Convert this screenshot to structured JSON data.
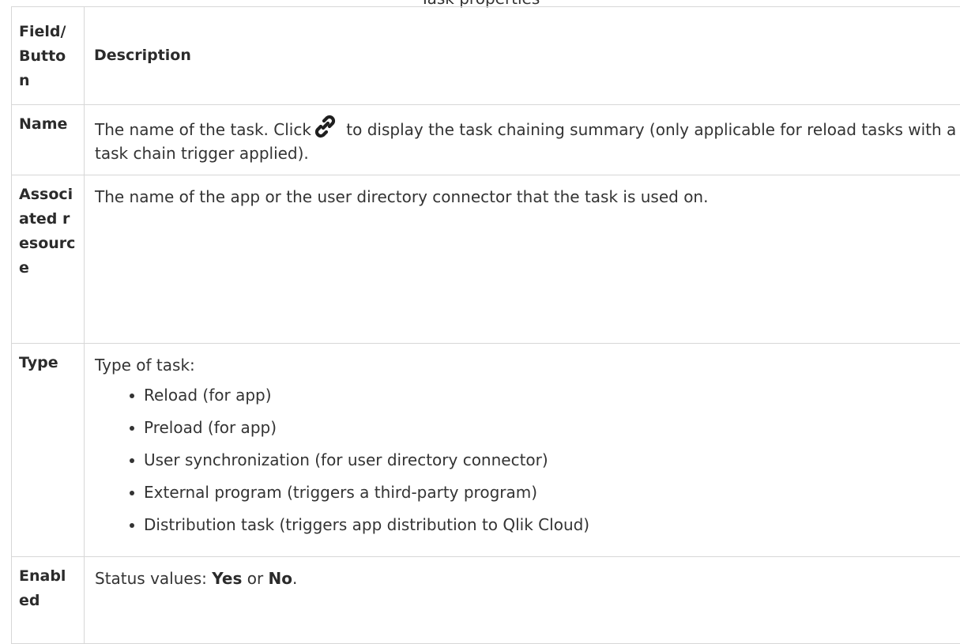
{
  "caption": "Task properties",
  "table": {
    "header": {
      "field": "Field/ Button",
      "description": "Description"
    },
    "rows": {
      "name": {
        "field": "Name",
        "text_before": "The name of the task. Click",
        "icon": "link-icon",
        "text_after": " to display the task chaining summary (only applicable for reload tasks with a task chain trigger applied)."
      },
      "associated_resource": {
        "field": "Associated resource",
        "text": "The name of the app or the user directory connector that the task is used on."
      },
      "type": {
        "field": "Type",
        "intro": "Type of task:",
        "items": [
          "Reload (for app)",
          "Preload (for app)",
          "User synchronization (for user directory connector)",
          "External program (triggers a third-party program)",
          "Distribution task (triggers app distribution to Qlik Cloud)"
        ]
      },
      "enabled": {
        "field": "Enabled",
        "text_before": "Status values: ",
        "value_yes": "Yes",
        "text_middle": " or ",
        "value_no": "No",
        "text_after": "."
      }
    }
  }
}
